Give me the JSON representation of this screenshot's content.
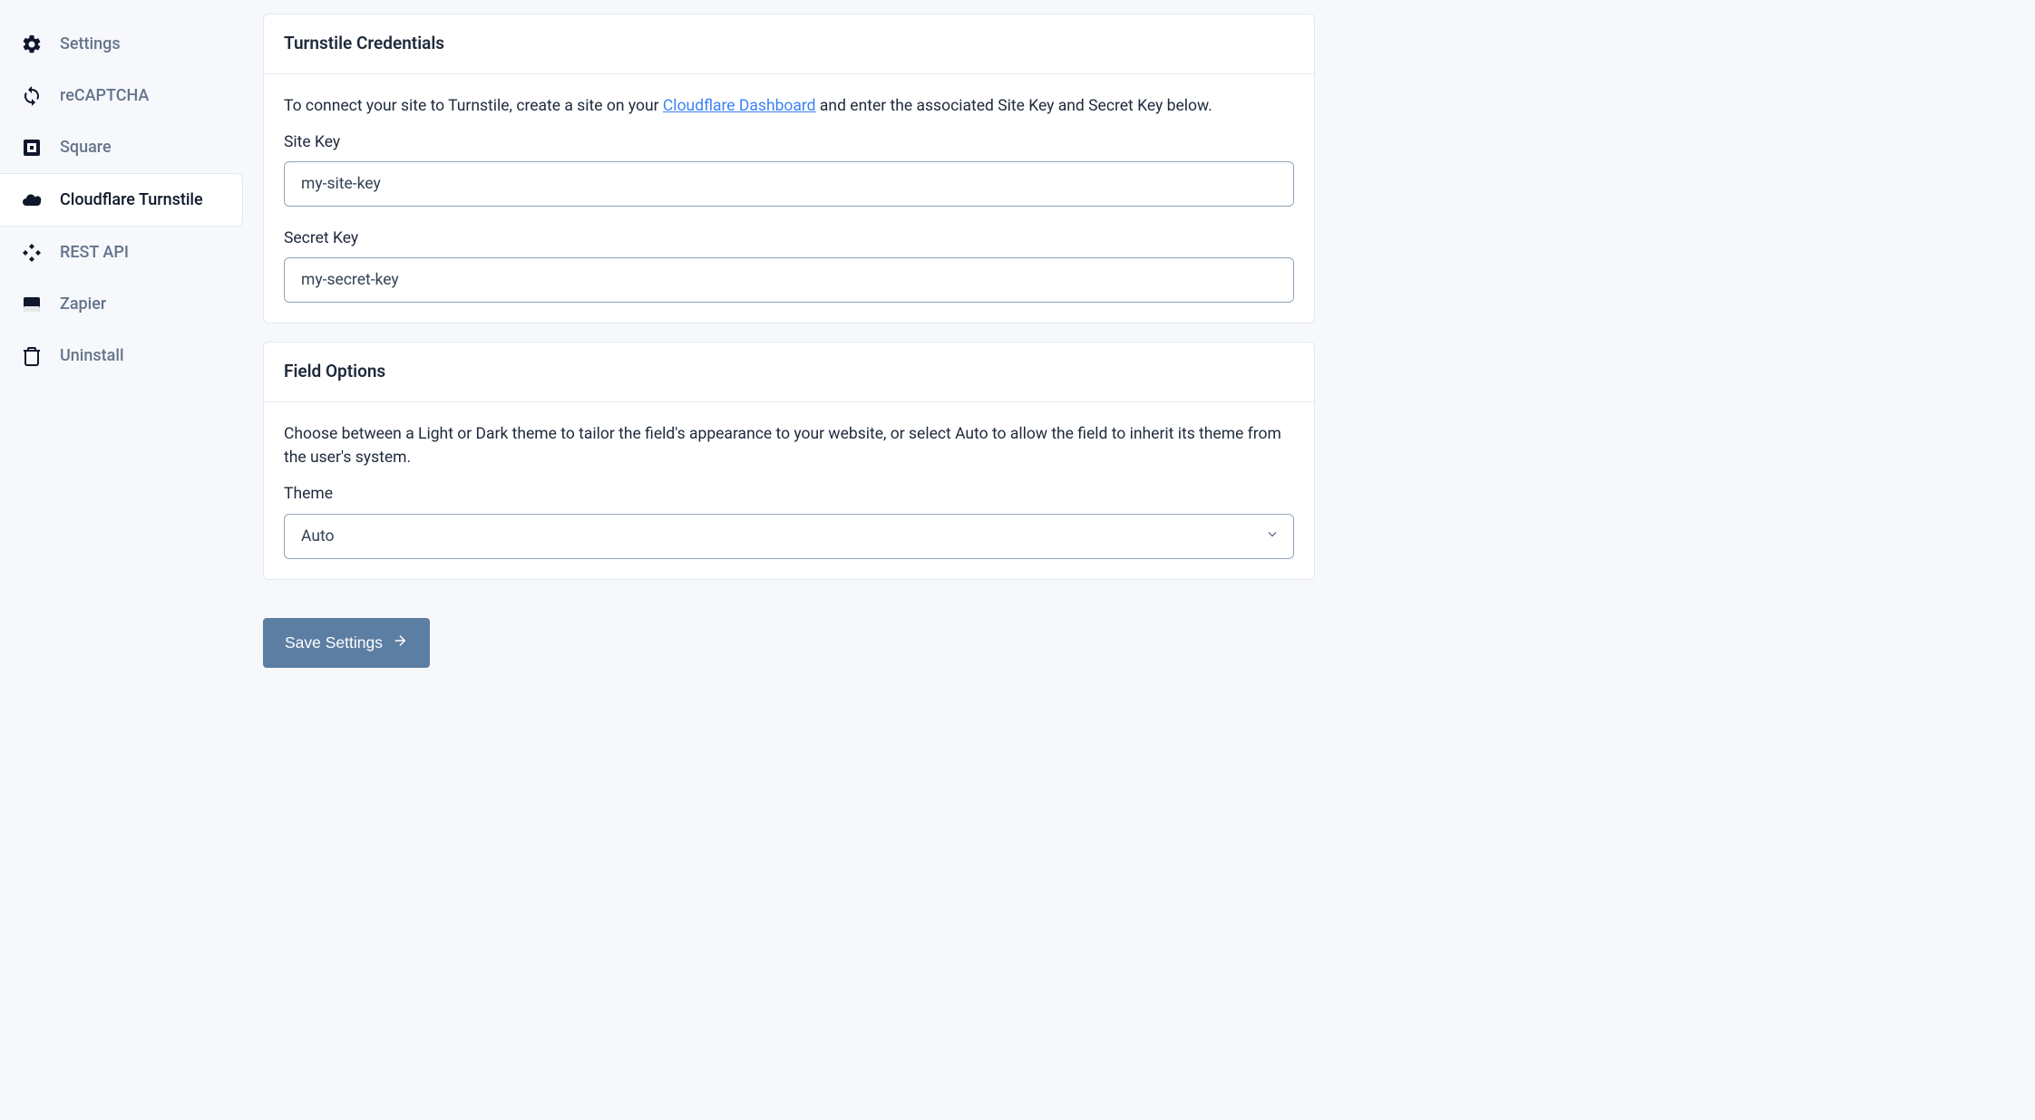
{
  "sidebar": {
    "items": [
      {
        "label": "Settings",
        "icon": "gear-icon",
        "active": false
      },
      {
        "label": "reCAPTCHA",
        "icon": "refresh-icon",
        "active": false
      },
      {
        "label": "Square",
        "icon": "square-icon",
        "active": false
      },
      {
        "label": "Cloudflare Turnstile",
        "icon": "cloud-icon",
        "active": true
      },
      {
        "label": "REST API",
        "icon": "diamond-icon",
        "active": false
      },
      {
        "label": "Zapier",
        "icon": "zapier-icon",
        "active": false
      },
      {
        "label": "Uninstall",
        "icon": "trash-icon",
        "active": false
      }
    ]
  },
  "credentials": {
    "title": "Turnstile Credentials",
    "desc_prefix": "To connect your site to Turnstile, create a site on your ",
    "link_text": "Cloudflare Dashboard",
    "desc_suffix": " and enter the associated Site Key and Secret Key below.",
    "site_key_label": "Site Key",
    "site_key_value": "my-site-key",
    "secret_key_label": "Secret Key",
    "secret_key_value": "my-secret-key"
  },
  "field_options": {
    "title": "Field Options",
    "desc": "Choose between a Light or Dark theme to tailor the field's appearance to your website, or select Auto to allow the field to inherit its theme from the user's system.",
    "theme_label": "Theme",
    "theme_value": "Auto"
  },
  "actions": {
    "save_label": "Save Settings"
  }
}
